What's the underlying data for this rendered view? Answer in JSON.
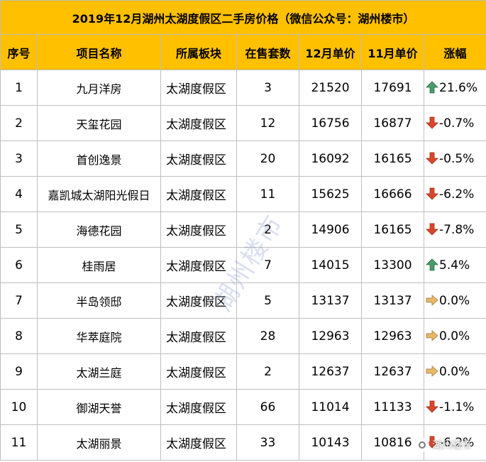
{
  "title": "2019年12月湖州太湖度假区二手房价格（微信公众号：湖州楼市）",
  "headers": [
    "序号",
    "项目名称",
    "所属板块",
    "在售套数",
    "12月单价",
    "11月单价",
    "涨幅"
  ],
  "rows": [
    {
      "no": "1",
      "name": "九月洋房",
      "board": "太湖度假区",
      "count": "3",
      "dec": "21520",
      "nov": "17691",
      "change": "21.6%",
      "trend": "up"
    },
    {
      "no": "2",
      "name": "天玺花园",
      "board": "太湖度假区",
      "count": "12",
      "dec": "16756",
      "nov": "16877",
      "change": "-0.7%",
      "trend": "down"
    },
    {
      "no": "3",
      "name": "首创逸景",
      "board": "太湖度假区",
      "count": "20",
      "dec": "16092",
      "nov": "16165",
      "change": "-0.5%",
      "trend": "down"
    },
    {
      "no": "4",
      "name": "嘉凯城太湖阳光假日",
      "board": "太湖度假区",
      "count": "11",
      "dec": "15625",
      "nov": "16666",
      "change": "-6.2%",
      "trend": "down"
    },
    {
      "no": "5",
      "name": "海德花园",
      "board": "太湖度假区",
      "count": "2",
      "dec": "14906",
      "nov": "16165",
      "change": "-7.8%",
      "trend": "down"
    },
    {
      "no": "6",
      "name": "桂雨居",
      "board": "太湖度假区",
      "count": "7",
      "dec": "14015",
      "nov": "13300",
      "change": "5.4%",
      "trend": "up"
    },
    {
      "no": "7",
      "name": "半岛领邸",
      "board": "太湖度假区",
      "count": "5",
      "dec": "13137",
      "nov": "13137",
      "change": "0.0%",
      "trend": "flat"
    },
    {
      "no": "8",
      "name": "华萃庭院",
      "board": "太湖度假区",
      "count": "28",
      "dec": "12963",
      "nov": "12963",
      "change": "0.0%",
      "trend": "flat"
    },
    {
      "no": "9",
      "name": "太湖兰庭",
      "board": "太湖度假区",
      "count": "2",
      "dec": "12637",
      "nov": "12637",
      "change": "0.0%",
      "trend": "flat"
    },
    {
      "no": "10",
      "name": "御湖天誉",
      "board": "太湖度假区",
      "count": "66",
      "dec": "11014",
      "nov": "11133",
      "change": "-1.1%",
      "trend": "down"
    },
    {
      "no": "11",
      "name": "太湖丽景",
      "board": "太湖度假区",
      "count": "33",
      "dec": "10143",
      "nov": "10816",
      "change": "-6.2%",
      "trend": "down"
    }
  ],
  "trend_colors": {
    "up": "#4a9a6a",
    "down": "#d9472b",
    "flat": "#e8b86a"
  },
  "watermark": "湖州楼市",
  "badge": {
    "text": "湖州楼市",
    "icon": "wechat-icon"
  }
}
